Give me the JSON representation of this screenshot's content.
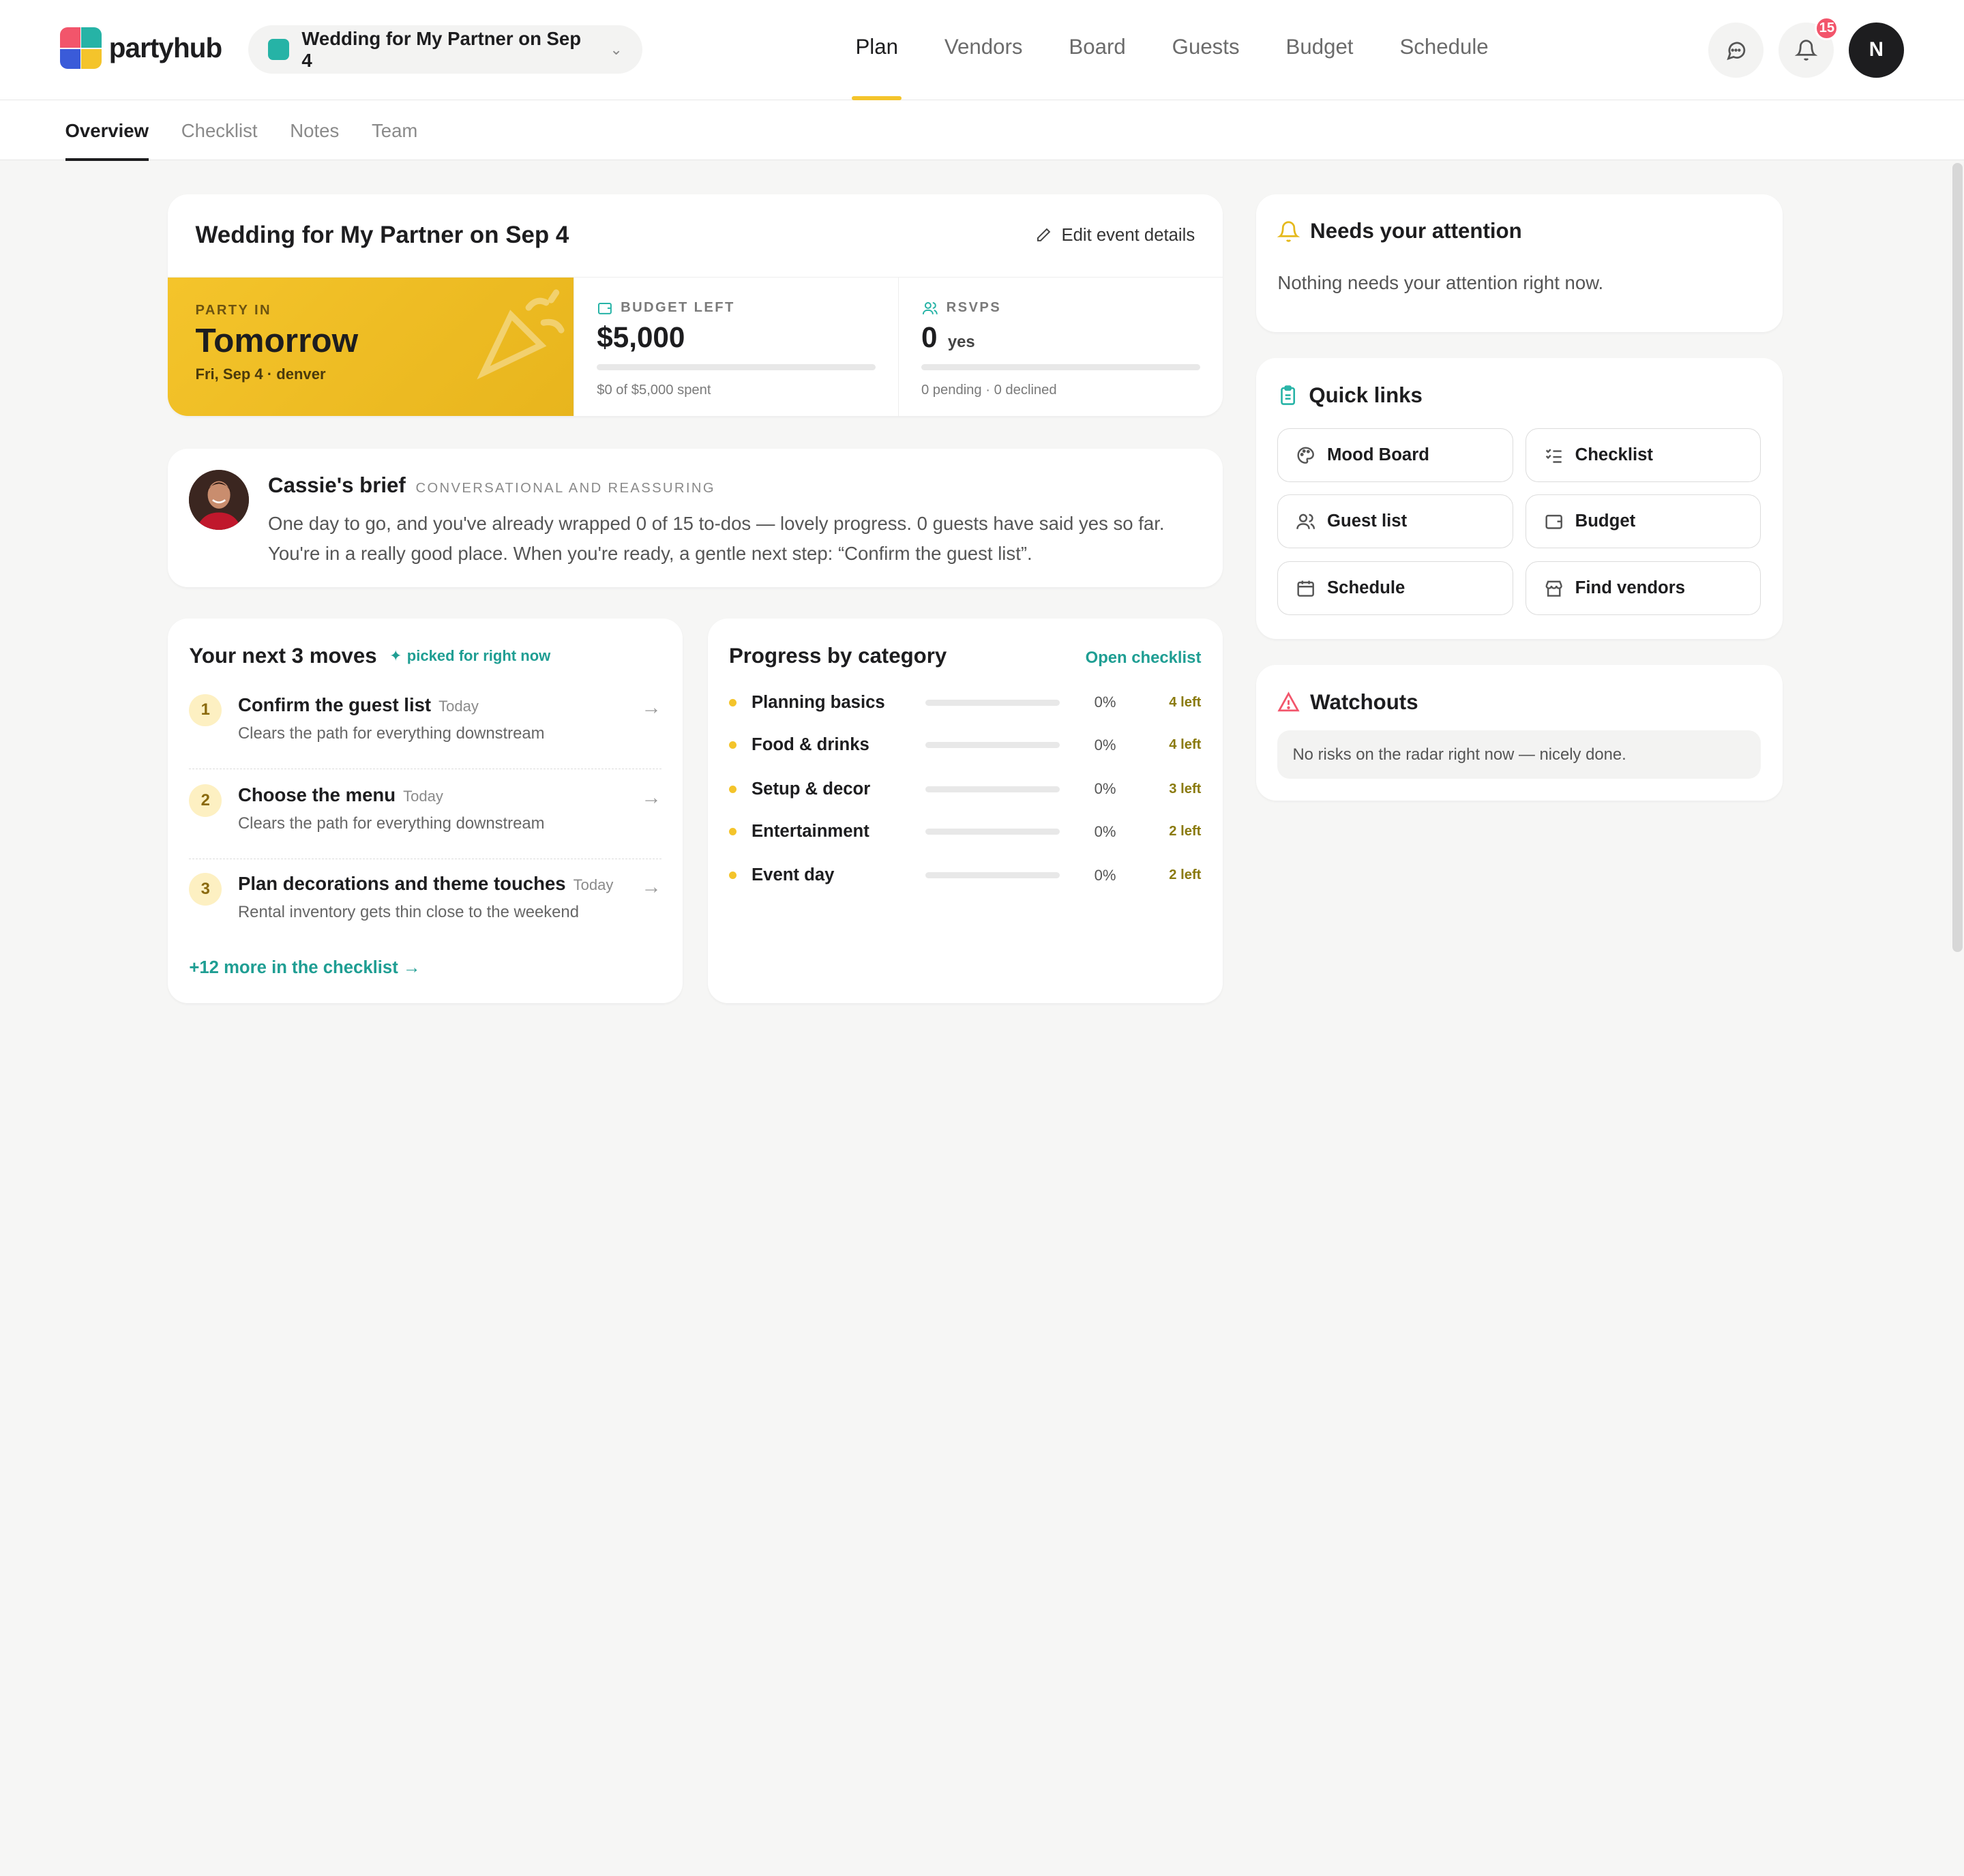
{
  "app": {
    "name": "partyhub"
  },
  "header": {
    "event_select_label": "Wedding for My Partner on Sep 4",
    "nav": [
      {
        "label": "Plan",
        "active": true
      },
      {
        "label": "Vendors",
        "active": false
      },
      {
        "label": "Board",
        "active": false
      },
      {
        "label": "Guests",
        "active": false
      },
      {
        "label": "Budget",
        "active": false
      },
      {
        "label": "Schedule",
        "active": false
      }
    ],
    "notification_count": "15",
    "avatar_initial": "N"
  },
  "subtabs": [
    {
      "label": "Overview",
      "active": true
    },
    {
      "label": "Checklist",
      "active": false
    },
    {
      "label": "Notes",
      "active": false
    },
    {
      "label": "Team",
      "active": false
    }
  ],
  "event_card": {
    "title": "Wedding for My Partner on Sep 4",
    "edit_label": "Edit event details",
    "party_in_label": "PARTY IN",
    "party_in_value": "Tomorrow",
    "party_in_sub": "Fri, Sep 4 · denver",
    "budget_label": "BUDGET LEFT",
    "budget_value": "$5,000",
    "budget_sub": "$0 of $5,000 spent",
    "budget_progress": 0,
    "rsvp_label": "RSVPS",
    "rsvp_value": "0",
    "rsvp_unit": "yes",
    "rsvp_sub": "0 pending · 0 declined",
    "rsvp_progress": 0
  },
  "brief": {
    "name": "Cassie's brief",
    "tone": "CONVERSATIONAL AND REASSURING",
    "text": "One day to go, and you've already wrapped 0 of 15 to-dos — lovely progress. 0 guests have said yes so far. You're in a really good place. When you're ready, a gentle next step: “Confirm the guest list”."
  },
  "moves": {
    "title": "Your next 3 moves",
    "picked_label": "picked for right now",
    "items": [
      {
        "num": "1",
        "title": "Confirm the guest list",
        "when": "Today",
        "desc": "Clears the path for everything downstream"
      },
      {
        "num": "2",
        "title": "Choose the menu",
        "when": "Today",
        "desc": "Clears the path for everything downstream"
      },
      {
        "num": "3",
        "title": "Plan decorations and theme touches",
        "when": "Today",
        "desc": "Rental inventory gets thin close to the weekend"
      }
    ],
    "more_label": "+12 more in the checklist →"
  },
  "progress": {
    "title": "Progress by category",
    "open_label": "Open checklist",
    "rows": [
      {
        "name": "Planning basics",
        "pct": "0%",
        "value": 0,
        "left": "4 left"
      },
      {
        "name": "Food & drinks",
        "pct": "0%",
        "value": 0,
        "left": "4 left"
      },
      {
        "name": "Setup & decor",
        "pct": "0%",
        "value": 0,
        "left": "3 left"
      },
      {
        "name": "Entertainment",
        "pct": "0%",
        "value": 0,
        "left": "2 left"
      },
      {
        "name": "Event day",
        "pct": "0%",
        "value": 0,
        "left": "2 left"
      }
    ]
  },
  "attention": {
    "title": "Needs your attention",
    "text": "Nothing needs your attention right now."
  },
  "quick_links": {
    "title": "Quick links",
    "items": [
      {
        "label": "Mood Board",
        "icon": "palette-icon"
      },
      {
        "label": "Checklist",
        "icon": "checklist-icon"
      },
      {
        "label": "Guest list",
        "icon": "users-icon"
      },
      {
        "label": "Budget",
        "icon": "wallet-icon"
      },
      {
        "label": "Schedule",
        "icon": "calendar-icon"
      },
      {
        "label": "Find vendors",
        "icon": "store-icon"
      }
    ]
  },
  "watchouts": {
    "title": "Watchouts",
    "text": "No risks on the radar right now — nicely done."
  },
  "colors": {
    "accent_yellow": "#f4c42b",
    "accent_teal": "#26b3a6",
    "badge_red": "#f2556b"
  }
}
